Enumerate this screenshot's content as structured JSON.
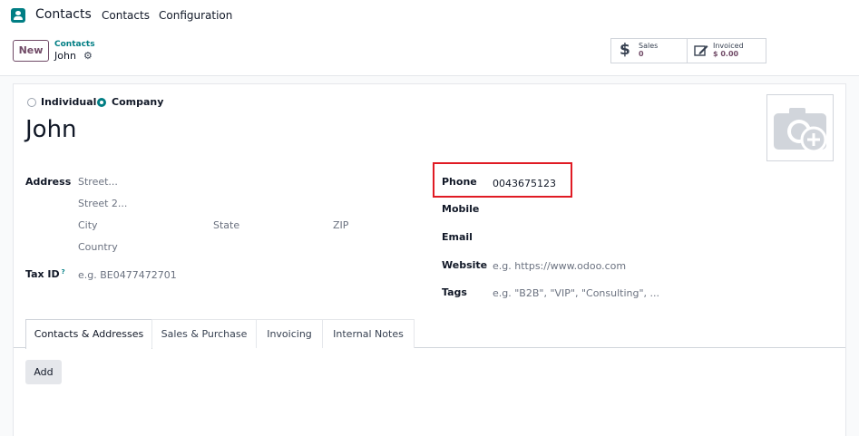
{
  "app": {
    "name": "Contacts",
    "menu": [
      "Contacts",
      "Configuration"
    ]
  },
  "control_panel": {
    "new_label": "New",
    "breadcrumb_parent": "Contacts",
    "breadcrumb_current": "John"
  },
  "smart_buttons": {
    "sales": {
      "label": "Sales",
      "value": "0"
    },
    "invoiced": {
      "label": "Invoiced",
      "value": "$ 0.00"
    }
  },
  "form": {
    "type_options": [
      "Individual",
      "Company"
    ],
    "type_selected": "Company",
    "name": "John",
    "address": {
      "label": "Address",
      "street_placeholder": "Street...",
      "street2_placeholder": "Street 2...",
      "city_placeholder": "City",
      "state_placeholder": "State",
      "zip_placeholder": "ZIP",
      "country_placeholder": "Country"
    },
    "tax_id": {
      "label": "Tax ID",
      "help": "?",
      "placeholder": "e.g. BE0477472701"
    },
    "phone": {
      "label": "Phone",
      "value": "0043675123"
    },
    "mobile": {
      "label": "Mobile",
      "value": ""
    },
    "email": {
      "label": "Email",
      "value": ""
    },
    "website": {
      "label": "Website",
      "placeholder": "e.g. https://www.odoo.com"
    },
    "tags": {
      "label": "Tags",
      "placeholder": "e.g. \"B2B\", \"VIP\", \"Consulting\", ..."
    }
  },
  "tabs": [
    "Contacts & Addresses",
    "Sales & Purchase",
    "Invoicing",
    "Internal Notes"
  ],
  "active_tab": "Contacts & Addresses",
  "add_label": "Add",
  "colors": {
    "brand": "#714b67",
    "accent": "#017e84",
    "highlight": "#e01b24"
  }
}
